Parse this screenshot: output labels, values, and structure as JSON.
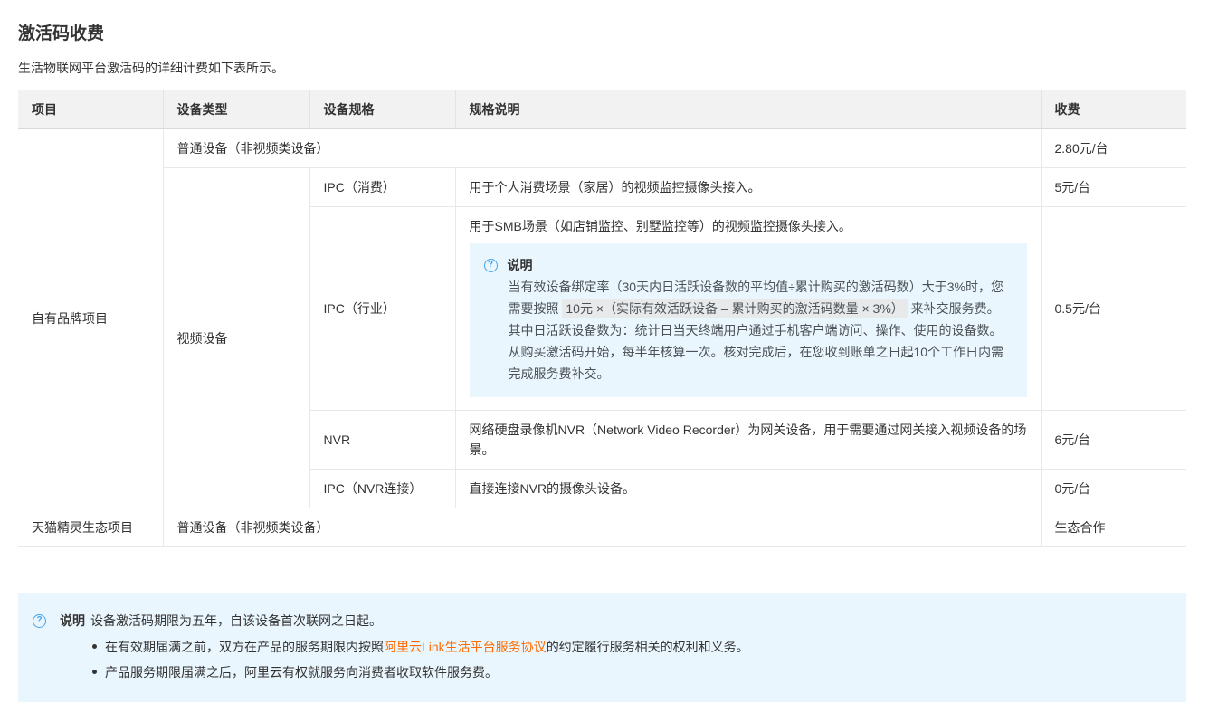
{
  "page": {
    "title": "激活码收费",
    "intro": "生活物联网平台激活码的详细计费如下表所示。"
  },
  "colors": {
    "accent_blue": "#46a3e9",
    "link_orange": "#ff6a00",
    "note_bg": "#e9f6fd",
    "header_bg": "#f2f2f2",
    "border": "#e8e8e8"
  },
  "table": {
    "headers": {
      "project": "项目",
      "device_type": "设备类型",
      "device_spec": "设备规格",
      "spec_desc": "规格说明",
      "fee": "收费"
    },
    "cells": {
      "own_brand_project": "自有品牌项目",
      "tmall_project": "天猫精灵生态项目",
      "video_device": "视频设备",
      "normal_device": "普通设备（非视频类设备）",
      "normal_device_fee": "2.80元/台",
      "tmall_fee": "生态合作",
      "ipc_consumer": {
        "spec": "IPC（消费）",
        "desc": "用于个人消费场景（家居）的视频监控摄像头接入。",
        "fee": "5元/台"
      },
      "ipc_industry": {
        "spec": "IPC（行业）",
        "desc": "用于SMB场景（如店铺监控、别墅监控等）的视频监控摄像头接入。",
        "fee": "0.5元/台"
      },
      "nvr": {
        "spec": "NVR",
        "desc": "网络硬盘录像机NVR（Network Video Recorder）为网关设备，用于需要通过网关接入视频设备的场景。",
        "fee": "6元/台"
      },
      "ipc_nvr": {
        "spec": "IPC（NVR连接）",
        "desc": "直接连接NVR的摄像头设备。",
        "fee": "0元/台"
      }
    },
    "inline_note": {
      "icon": "question-circle-icon",
      "label": "说明",
      "p1_prefix": "当有效设备绑定率（30天内日活跃设备数的平均值÷累计购买的激活码数）大于3%时，您需要按照 ",
      "p1_code": "10元 ×（实际有效活跃设备 – 累计购买的激活码数量 × 3%）",
      "p1_suffix": " 来补交服务费。其中日活跃设备数为：统计日当天终端用户通过手机客户端访问、操作、使用的设备数。",
      "p2": "从购买激活码开始，每半年核算一次。核对完成后，在您收到账单之日起10个工作日内需完成服务费补交。"
    }
  },
  "bottom_note": {
    "icon": "question-circle-icon",
    "label": "说明",
    "text": "设备激活码期限为五年，自该设备首次联网之日起。",
    "bullet1": {
      "prefix": "在有效期届满之前，双方在产品的服务期限内按照",
      "link": "阿里云Link生活平台服务协议",
      "suffix": "的约定履行服务相关的权利和义务。"
    },
    "bullet2": "产品服务期限届满之后，阿里云有权就服务向消费者收取软件服务费。"
  },
  "icon_glyph": "?"
}
